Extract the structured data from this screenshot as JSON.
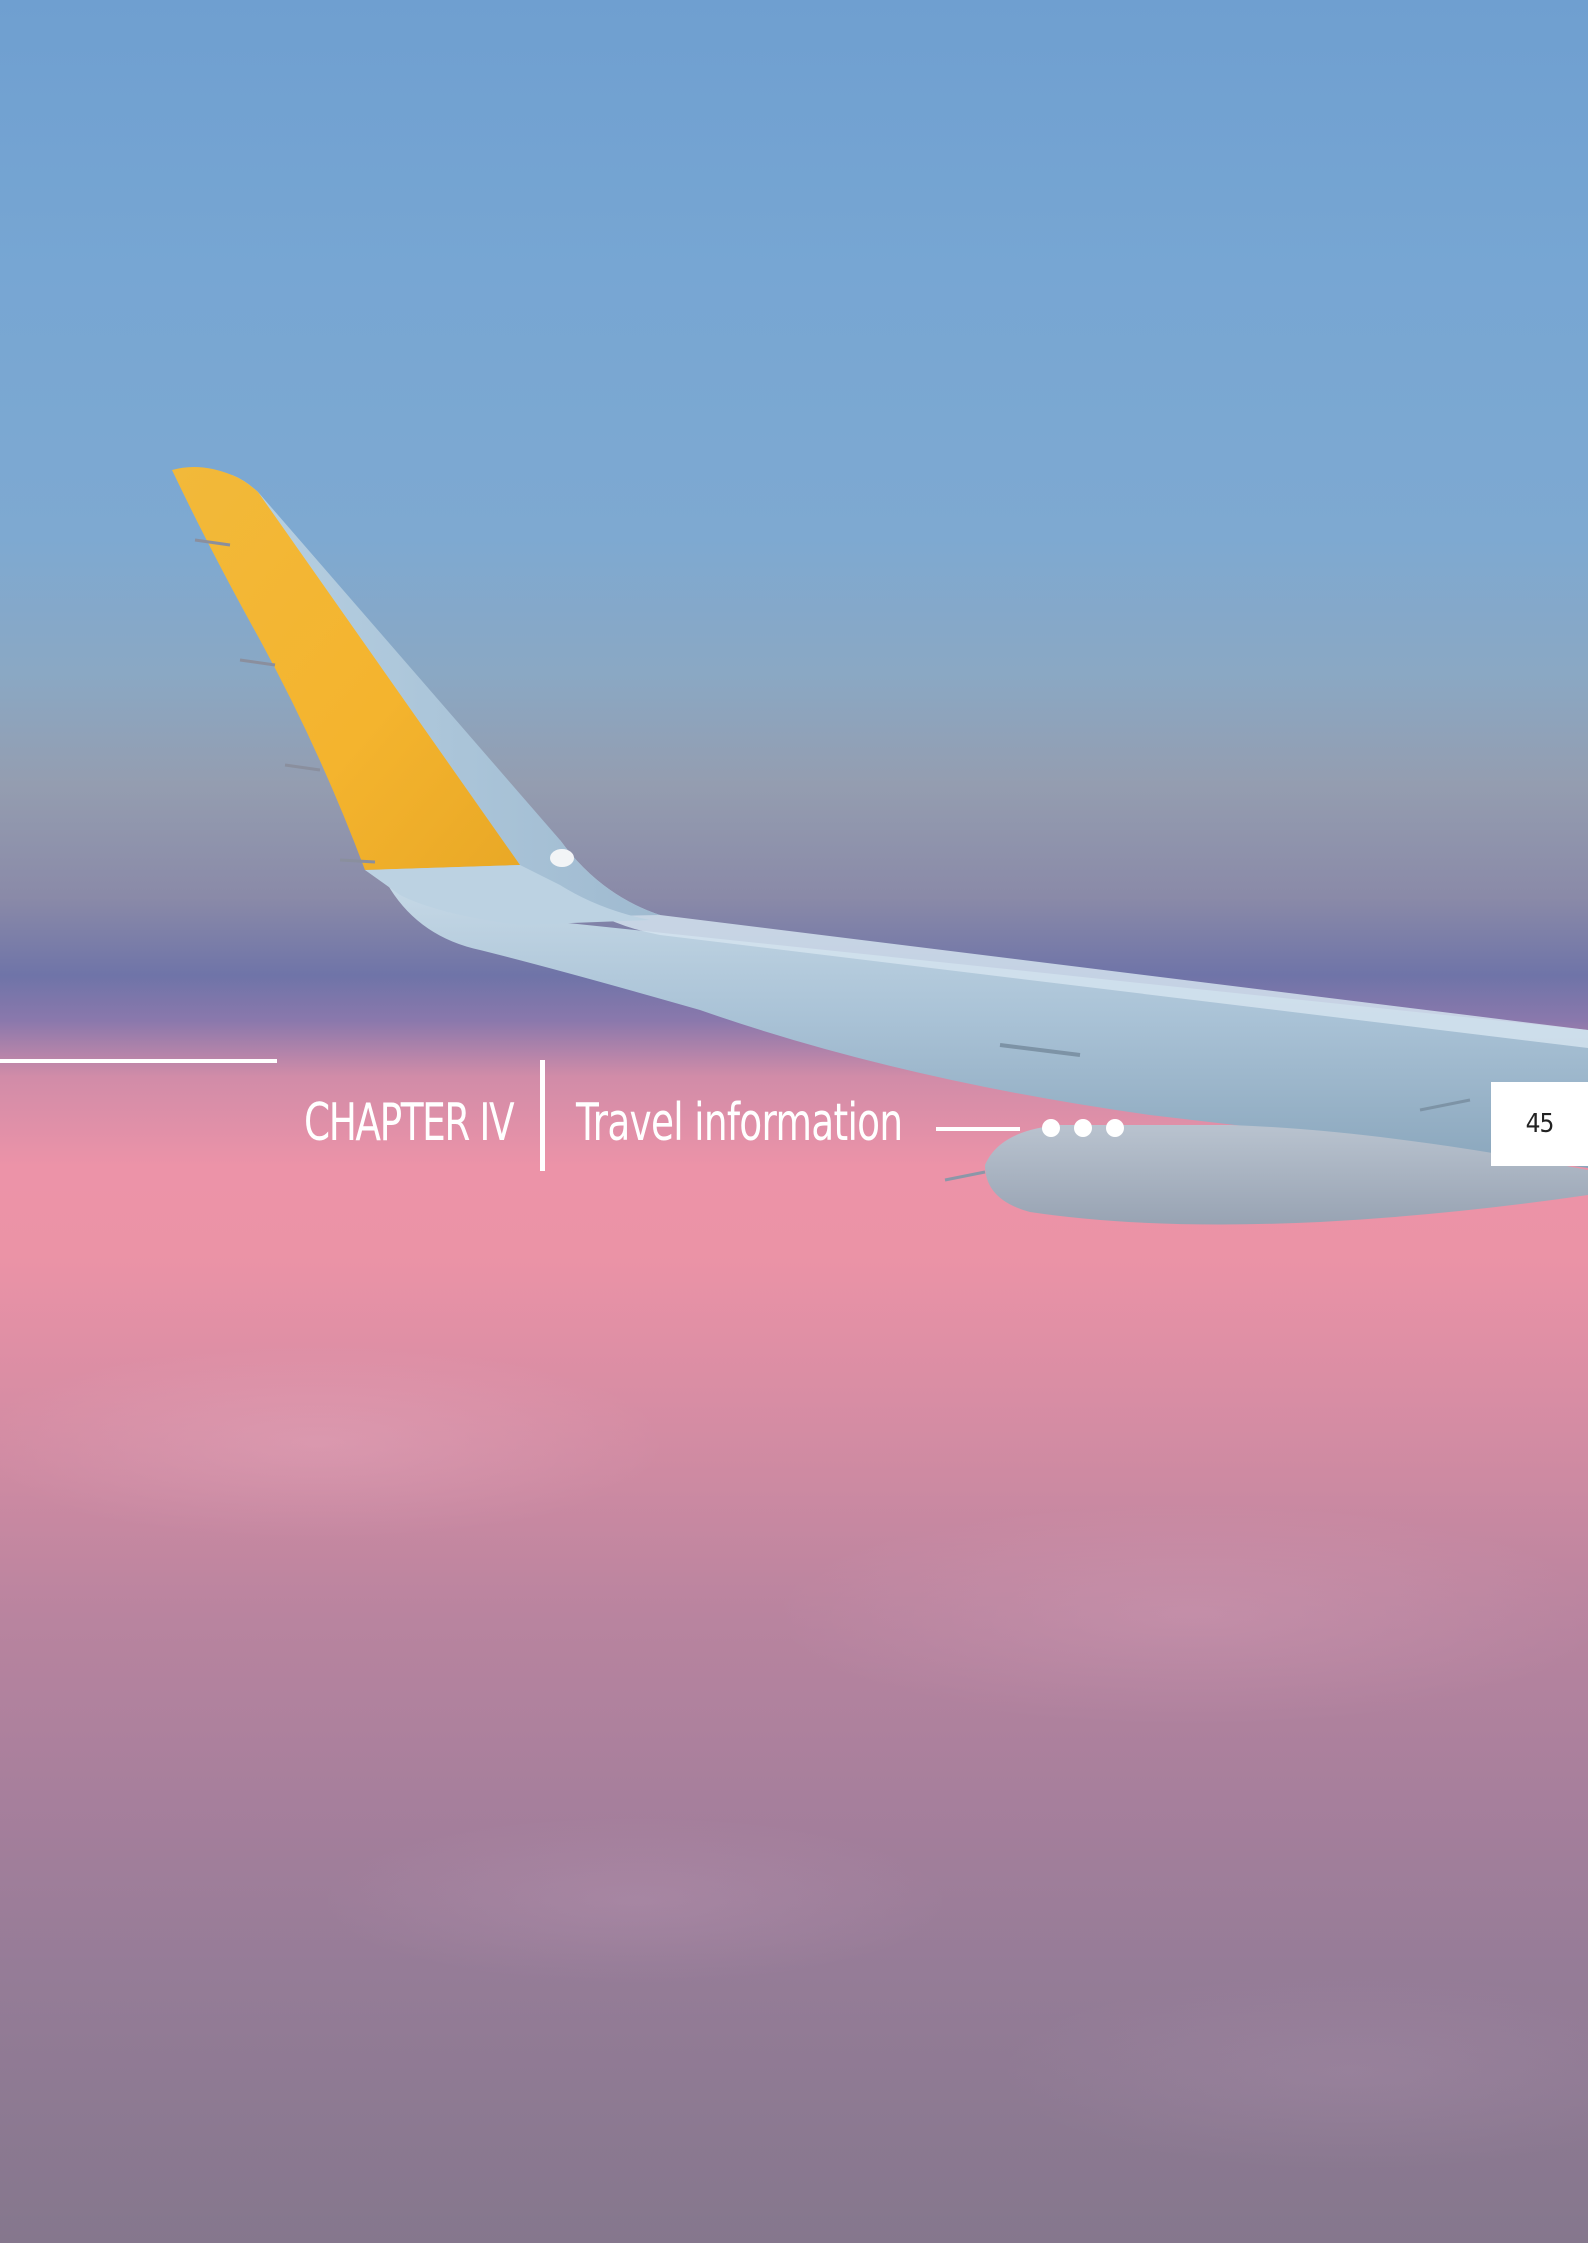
{
  "chapter": {
    "label": "CHAPTER IV",
    "title": "Travel information",
    "page_number": "45"
  },
  "background": {
    "description_icon": "airplane-wing-photo",
    "sky_color": "#6f9fd0",
    "cloud_color": "#eb93a6",
    "winglet_color": "#f4b630"
  },
  "colors": {
    "rule": "#ffffff",
    "text": "#ffffff",
    "page_number_box": "#ffffff",
    "page_number_text": "#222222"
  }
}
